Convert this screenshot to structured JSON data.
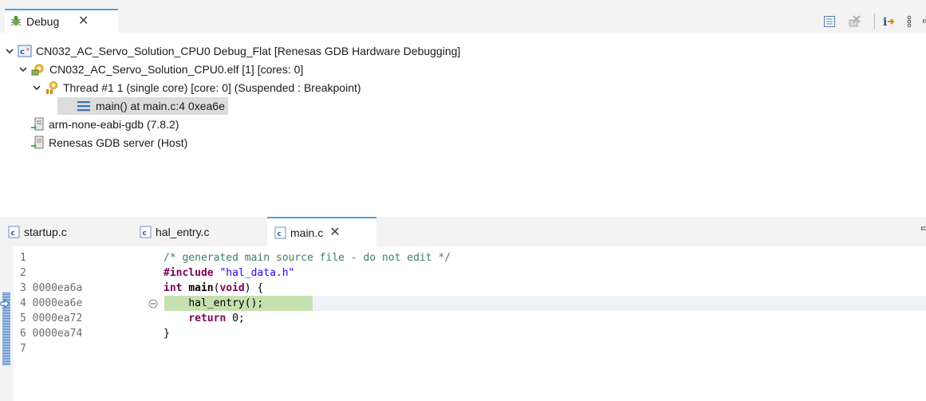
{
  "debug_view": {
    "tab_label": "Debug",
    "tab_close": "✕",
    "tree": {
      "launch": "CN032_AC_Servo_Solution_CPU0 Debug_Flat [Renesas GDB Hardware Debugging]",
      "process": "CN032_AC_Servo_Solution_CPU0.elf [1] [cores: 0]",
      "thread": "Thread #1 1 (single core) [core: 0] (Suspended : Breakpoint)",
      "frame": "main() at main.c:4 0xea6e",
      "gdb": "arm-none-eabi-gdb (7.8.2)",
      "server": "Renesas GDB server (Host)"
    },
    "toolbar_icons": [
      "collapse-all-icon",
      "remove-terminated-icon",
      "instruction-stepping-icon",
      "view-menu-icon",
      "minimize-icon"
    ]
  },
  "editor": {
    "tabs": [
      {
        "label": "startup.c",
        "active": false
      },
      {
        "label": "hal_entry.c",
        "active": false
      },
      {
        "label": "main.c",
        "active": true
      }
    ],
    "tab_close": "✕",
    "gutter": [
      {
        "line": "1",
        "addr": ""
      },
      {
        "line": "2",
        "addr": ""
      },
      {
        "line": "3",
        "addr": "0000ea6a"
      },
      {
        "line": "4",
        "addr": "0000ea6e"
      },
      {
        "line": "5",
        "addr": "0000ea72"
      },
      {
        "line": "6",
        "addr": "0000ea74"
      },
      {
        "line": "7",
        "addr": ""
      }
    ],
    "code": {
      "l1": "/* generated main source file - do not edit */",
      "l2_kw": "#include",
      "l2_str": "\"hal_data.h\"",
      "l3_kw1": "int",
      "l3_fn": "main",
      "l3_paren": "(",
      "l3_kw2": "void",
      "l3_rest": ") {",
      "l4_indent": "    ",
      "l4_call": "hal_entry();",
      "l5_indent": "    ",
      "l5_kw": "return",
      "l5_rest": " 0;",
      "l6": "}"
    },
    "current_line_color": "#c6e0b0"
  }
}
